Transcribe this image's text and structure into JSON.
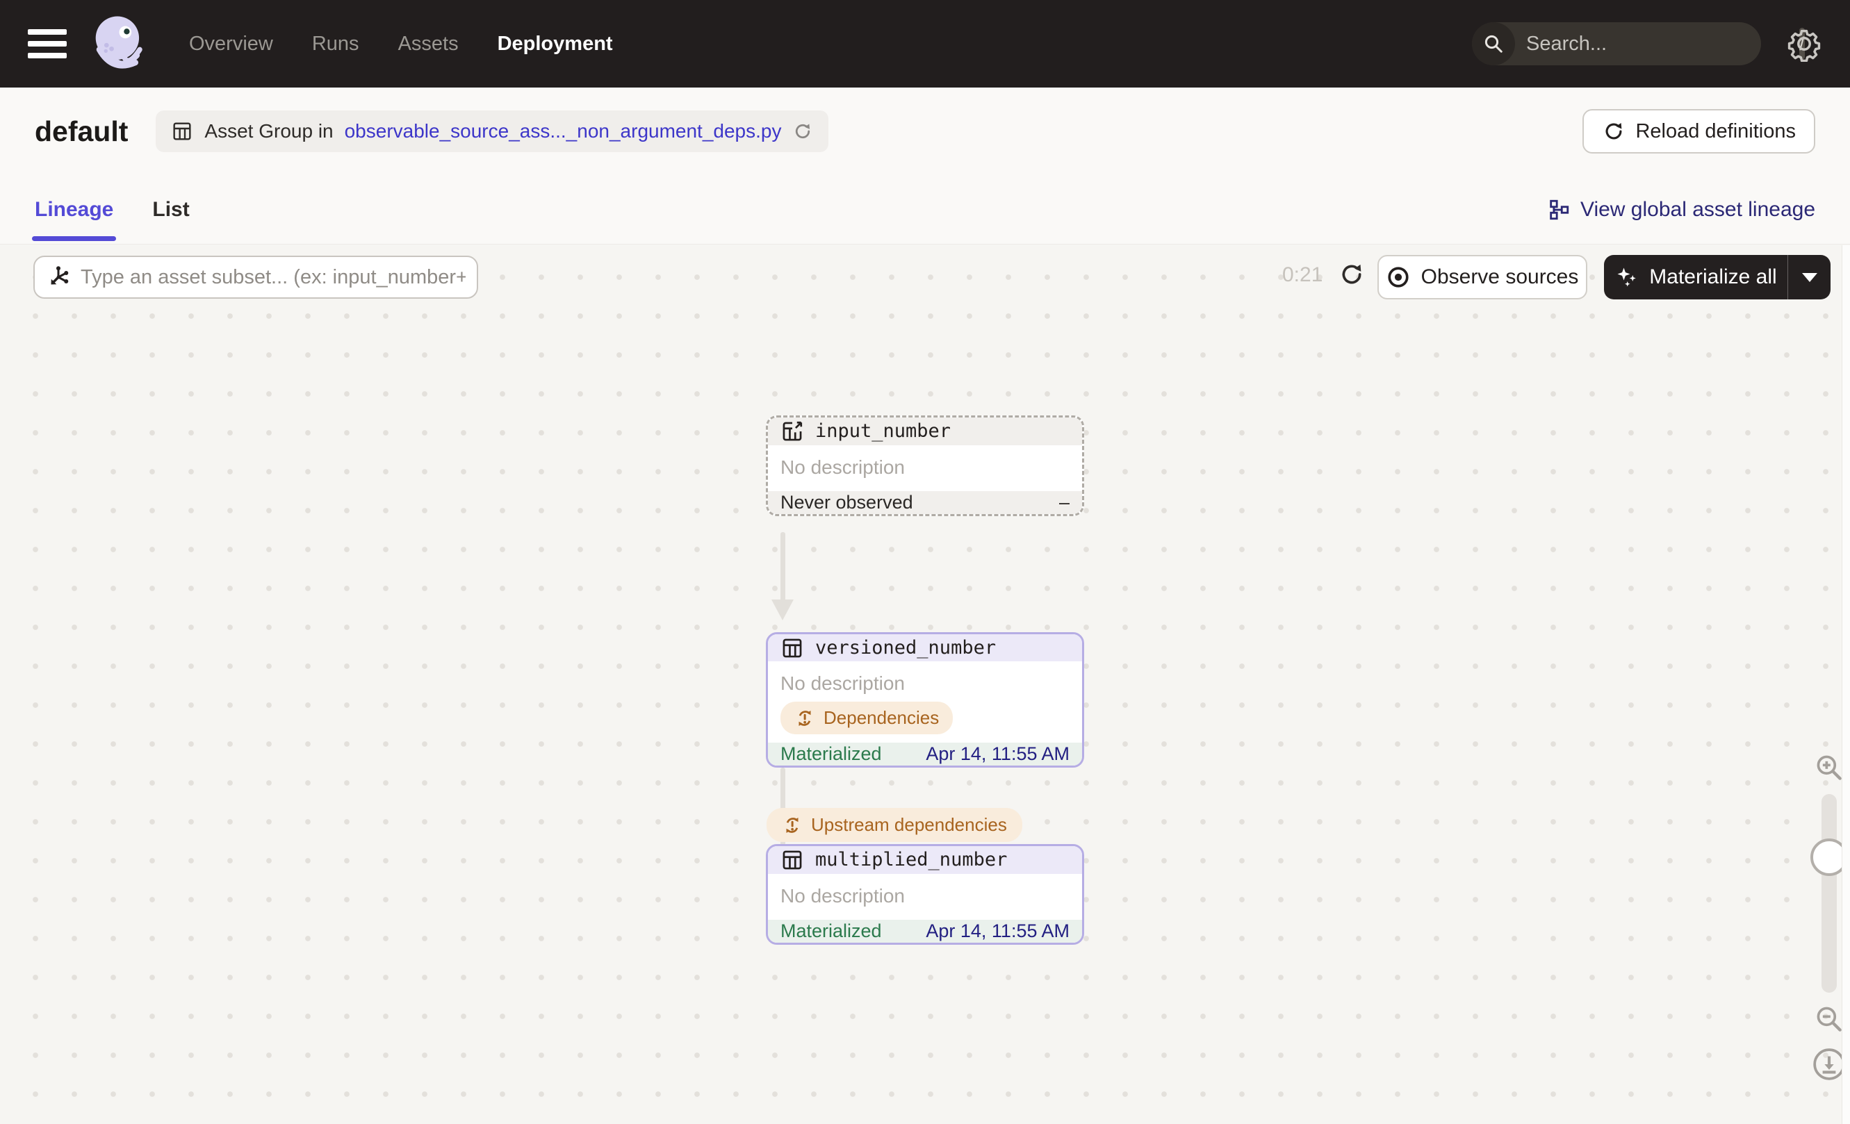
{
  "navbar": {
    "menu_items": [
      {
        "label": "Overview",
        "active": false
      },
      {
        "label": "Runs",
        "active": false
      },
      {
        "label": "Assets",
        "active": false
      },
      {
        "label": "Deployment",
        "active": true
      }
    ],
    "search_placeholder": "Search...",
    "search_shortcut": "/"
  },
  "header": {
    "title": "default",
    "asset_group_prefix": "Asset Group in",
    "asset_group_link": "observable_source_ass..._non_argument_deps.py",
    "reload_button": "Reload definitions"
  },
  "tabs": {
    "lineage": "Lineage",
    "list": "List",
    "global_lineage_link": "View global asset lineage"
  },
  "toolbar": {
    "subset_placeholder": "Type an asset subset... (ex: input_number+)",
    "timer": "0:21",
    "observe_button": "Observe sources",
    "materialize_button": "Materialize all"
  },
  "graph": {
    "edge_badge": "Upstream dependencies",
    "nodes": [
      {
        "name": "input_number",
        "description": "No description",
        "status": "Never observed",
        "status_value": "–",
        "kind": "observable-source-asset"
      },
      {
        "name": "versioned_number",
        "description": "No description",
        "badge": "Dependencies",
        "status": "Materialized",
        "status_value": "Apr 14, 11:55 AM",
        "kind": "materializable-asset"
      },
      {
        "name": "multiplied_number",
        "description": "No description",
        "status": "Materialized",
        "status_value": "Apr 14, 11:55 AM",
        "kind": "materializable-asset"
      }
    ]
  },
  "colors": {
    "navbar_bg": "#221E1E",
    "accent_blurple": "#544BD6",
    "link_blue": "#3D36C9",
    "node_border_purple": "#B6ADE4",
    "node_header_lavender": "#ECE9F8",
    "materialized_green": "#2B7A4C",
    "timestamp_navy": "#232082",
    "dependency_orange": "#A8641F",
    "dependency_pill_bg": "#F9ECDC",
    "canvas_bg": "#F6F5F2"
  }
}
